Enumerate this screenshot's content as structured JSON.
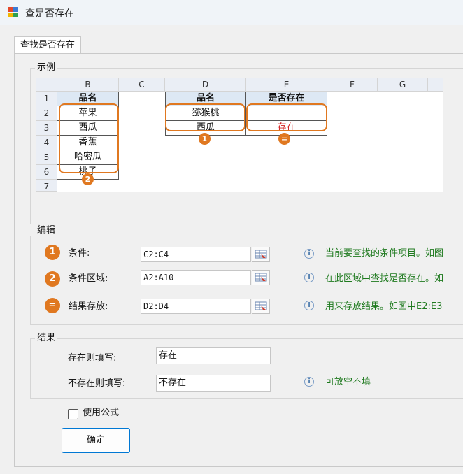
{
  "window": {
    "title": "查是否存在",
    "icon": "app-grid-icon"
  },
  "tab": {
    "label": "查找是否存在"
  },
  "example": {
    "legend": "示例",
    "col_headers": [
      "B",
      "C",
      "D",
      "E",
      "F",
      "G"
    ],
    "row_headers": [
      "1",
      "2",
      "3",
      "4",
      "5",
      "6",
      "7"
    ],
    "left_header": "品名",
    "left_items": [
      "苹果",
      "西瓜",
      "香蕉",
      "哈密瓜",
      "桃子"
    ],
    "mid_header": "品名",
    "mid_items": [
      "猕猴桃",
      "西瓜"
    ],
    "right_header": "是否存在",
    "right_items": [
      "",
      "存在"
    ],
    "badge1": "1",
    "badge2": "2",
    "badge_eq": "="
  },
  "edit": {
    "legend": "编辑",
    "rows": [
      {
        "badge": "1",
        "label": "条件:",
        "value": "C2:C4",
        "hint": "当前要查找的条件项目。如图"
      },
      {
        "badge": "2",
        "label": "条件区域:",
        "value": "A2:A10",
        "hint": "在此区域中查找是否存在。如"
      },
      {
        "badge": "=",
        "label": "结果存放:",
        "value": "D2:D4",
        "hint": "用来存放结果。如图中E2:E3"
      }
    ]
  },
  "result": {
    "legend": "结果",
    "exist_label": "存在则填写:",
    "exist_value": "存在",
    "notexist_label": "不存在则填写:",
    "notexist_value": "不存在",
    "notexist_hint": "可放空不填"
  },
  "options": {
    "use_formula_label": "使用公式",
    "use_formula_checked": false
  },
  "footer": {
    "ok_label": "确定"
  },
  "colors": {
    "accent": "#e07820",
    "hint": "#1f7a1f",
    "exist_red": "#d21e1e",
    "primary": "#0078d4"
  }
}
